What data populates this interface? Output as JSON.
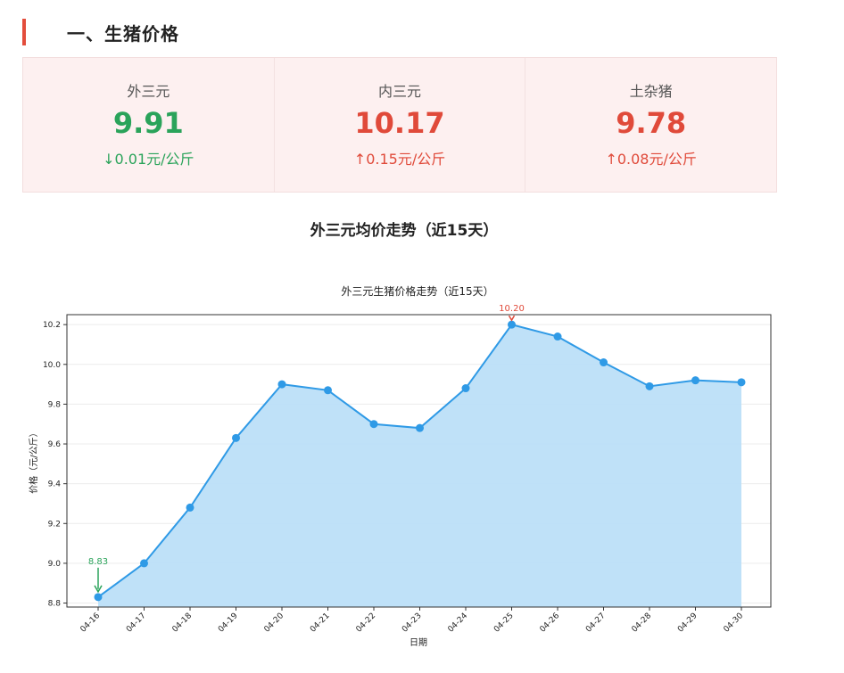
{
  "section": {
    "title": "一、生猪价格"
  },
  "cards": [
    {
      "name": "外三元",
      "price": "9.91",
      "change": "↓0.01元/公斤",
      "direction": "down"
    },
    {
      "name": "内三元",
      "price": "10.17",
      "change": "↑0.15元/公斤",
      "direction": "up"
    },
    {
      "name": "土杂猪",
      "price": "9.78",
      "change": "↑0.08元/公斤",
      "direction": "up"
    }
  ],
  "colors": {
    "up": "#e04a3a",
    "down": "#2aa35a",
    "line": "#2f9ae6",
    "fill": "#bcdff8"
  },
  "chart_heading": "外三元均价走势（近15天）",
  "chart_data": {
    "type": "area",
    "title": "外三元生猪价格走势（近15天）",
    "xlabel": "日期",
    "ylabel": "价格（元/公斤）",
    "categories": [
      "04-16",
      "04-17",
      "04-18",
      "04-19",
      "04-20",
      "04-21",
      "04-22",
      "04-23",
      "04-24",
      "04-25",
      "04-26",
      "04-27",
      "04-28",
      "04-29",
      "04-30"
    ],
    "values": [
      8.83,
      9.0,
      9.28,
      9.63,
      9.9,
      9.87,
      9.7,
      9.68,
      9.88,
      10.2,
      10.14,
      10.01,
      9.89,
      9.92,
      9.91
    ],
    "ylim": [
      8.78,
      10.25
    ],
    "yticks": [
      "8.8",
      "9.0",
      "9.2",
      "9.4",
      "9.6",
      "9.8",
      "10.0",
      "10.2"
    ],
    "grid": true,
    "annotations": [
      {
        "label": "8.83",
        "category": "04-16",
        "kind": "min"
      },
      {
        "label": "10.20",
        "category": "04-25",
        "kind": "max"
      }
    ]
  }
}
